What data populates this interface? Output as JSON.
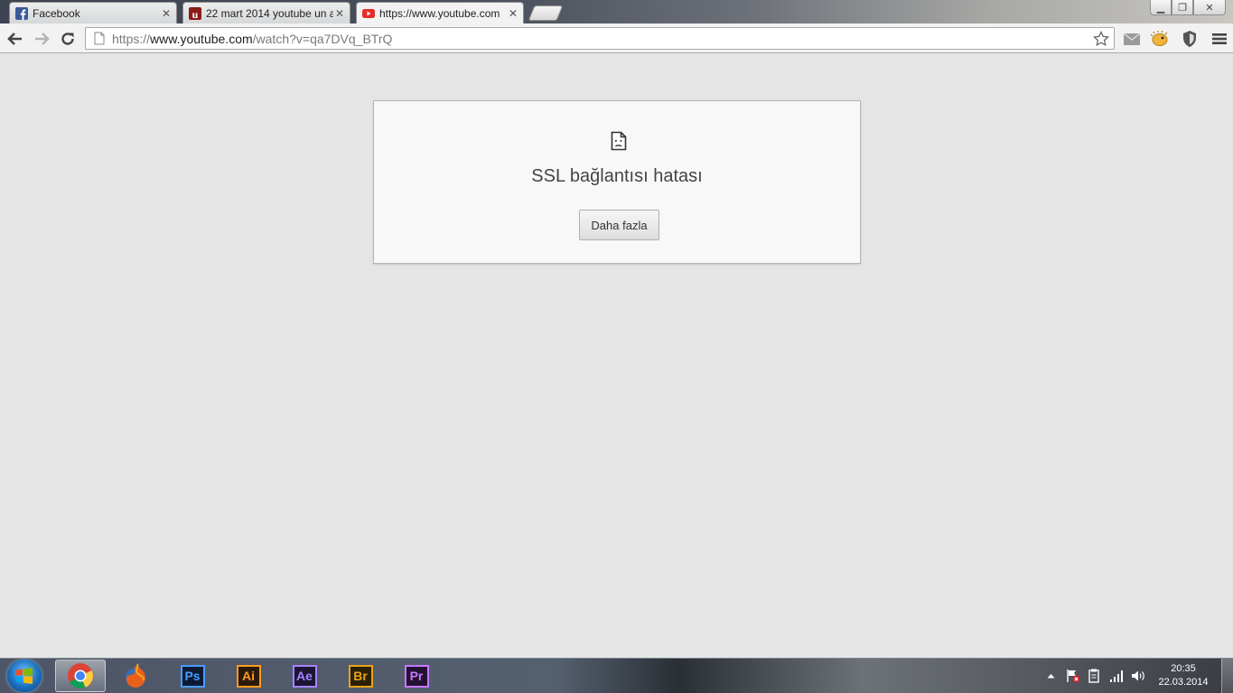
{
  "browser": {
    "tabs": [
      {
        "title": "Facebook",
        "favicon": "facebook-icon",
        "state": "inactive"
      },
      {
        "title": "22 mart 2014 youtube un a",
        "favicon": "uludag-sozluk-icon",
        "state": "inactive"
      },
      {
        "title": "https://www.youtube.com",
        "favicon": "youtube-icon",
        "state": "active"
      }
    ],
    "close_glyph": "✕",
    "window_buttons": {
      "minimize": "▁",
      "restore": "❐",
      "close": "✕"
    },
    "address": {
      "scheme": "https://",
      "host": "www.youtube.com",
      "path": "/watch?v=qa7DVq_BTrQ"
    },
    "extensions": [
      "mail-icon",
      "blowfish-icon",
      "shield-icon"
    ]
  },
  "page": {
    "error_title": "SSL bağlantısı hatası",
    "more_button": "Daha fazla"
  },
  "taskbar": {
    "pinned": [
      {
        "name": "chrome",
        "active": true
      },
      {
        "name": "firefox",
        "active": false
      },
      {
        "name": "photoshop",
        "label": "Ps",
        "color": "#4a9cff",
        "active": false
      },
      {
        "name": "illustrator",
        "label": "Ai",
        "color": "#ff9a1f",
        "active": false
      },
      {
        "name": "after-effects",
        "label": "Ae",
        "color": "#a582ff",
        "active": false
      },
      {
        "name": "bridge",
        "label": "Br",
        "color": "#e8a21a",
        "active": false
      },
      {
        "name": "premiere",
        "label": "Pr",
        "color": "#c878ff",
        "active": false
      }
    ],
    "clock": {
      "time": "20:35",
      "date": "22.03.2014"
    }
  }
}
